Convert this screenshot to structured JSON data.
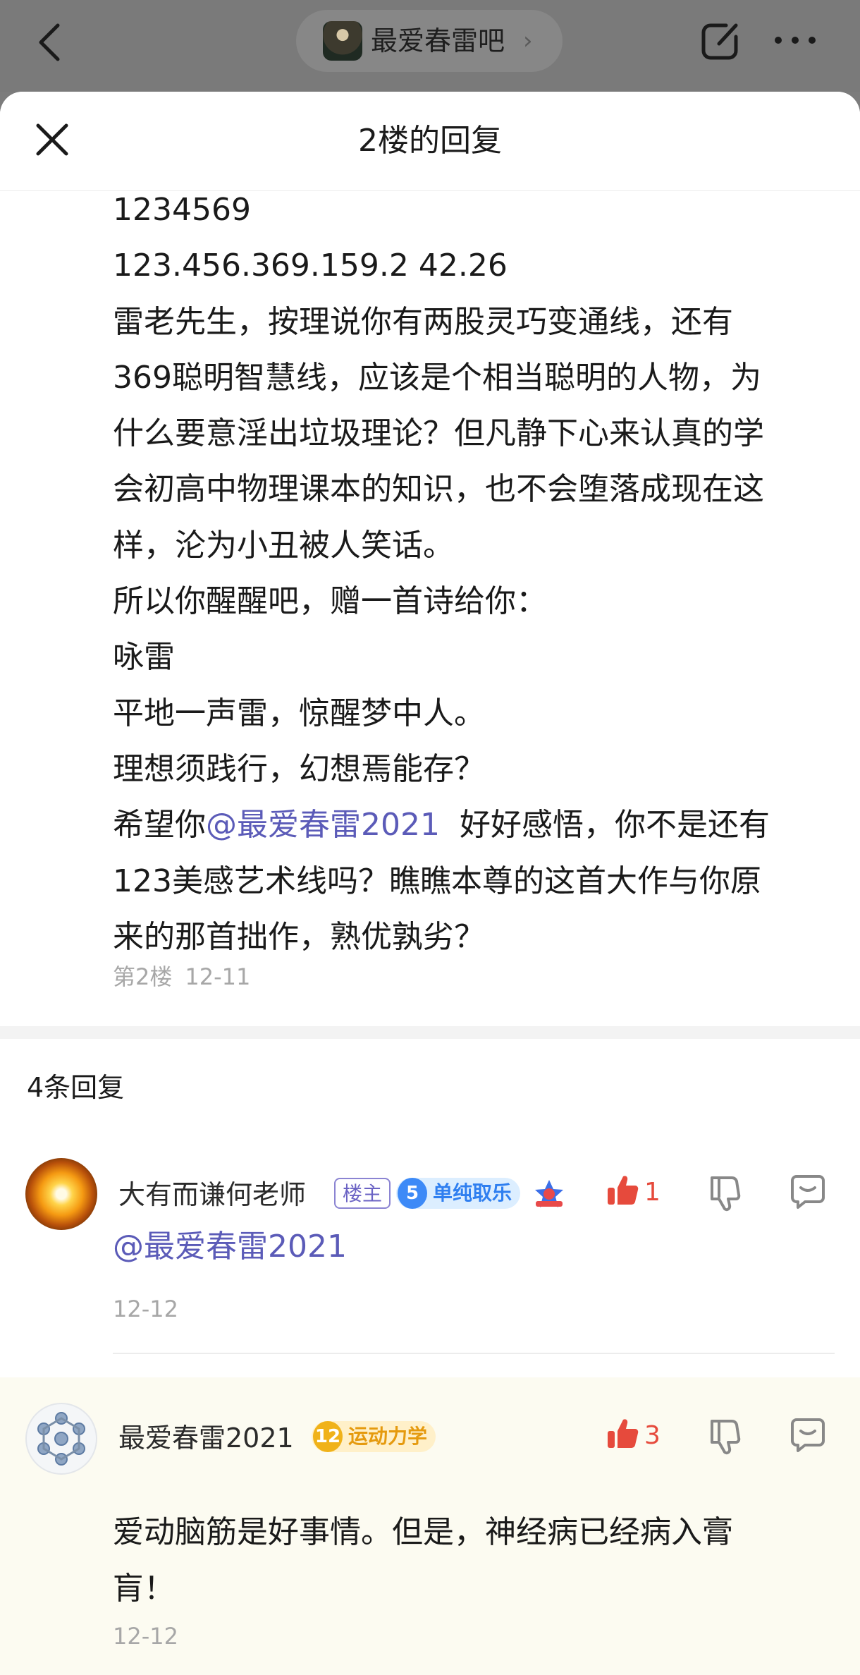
{
  "topbar": {
    "forum_name": "最爱春雷吧",
    "chevron": "›"
  },
  "sheet": {
    "title": "2楼的回复"
  },
  "post": {
    "lines": [
      "1234569",
      "123.456.369.159.2 42.26",
      "雷老先生，按理说你有两股灵巧变通线，还有",
      "369聪明智慧线，应该是个相当聪明的人物，为",
      "什么要意淫出垃圾理论？但凡静下心来认真的学",
      "会初高中物理课本的知识，也不会堕落成现在这",
      "样，沦为小丑被人笑话。",
      "所以你醒醒吧，赠一首诗给你：",
      "咏雷",
      "平地一声雷，惊醒梦中人。",
      "理想须践行，幻想焉能存？"
    ],
    "line12_before": "希望你",
    "line12_mention": "@最爱春雷2021",
    "line12_after": "  好好感悟，你不是还有",
    "line13": "123美感艺术线吗？瞧瞧本尊的这首大作与你原",
    "line14": "来的那首拙作，熟优孰劣？",
    "floor": "第2楼",
    "date": "12-11"
  },
  "reply_count": "4条回复",
  "replies": [
    {
      "username": "大有而谦何老师",
      "owner_badge": "楼主",
      "level": "5",
      "level_title": "单纯取乐",
      "likes": "1",
      "text_mention": "@最爱春雷2021",
      "time": "12-12"
    },
    {
      "username": "最爱春雷2021",
      "level": "12",
      "level_title": "运动力学",
      "likes": "3",
      "text_line1": "爱动脑筋是好事情。但是，神经病已经病入膏",
      "text_line2": "肓！",
      "time": "12-12"
    }
  ],
  "colors": {
    "like_red": "#e64a3c",
    "mention_purple": "#5b5bb8",
    "owner_badge": "#6b63c4"
  },
  "icons": [
    "back-arrow-icon",
    "share-icon",
    "more-icon",
    "close-icon",
    "thumb-up-icon",
    "thumb-down-icon",
    "comment-icon",
    "honor-icon"
  ]
}
